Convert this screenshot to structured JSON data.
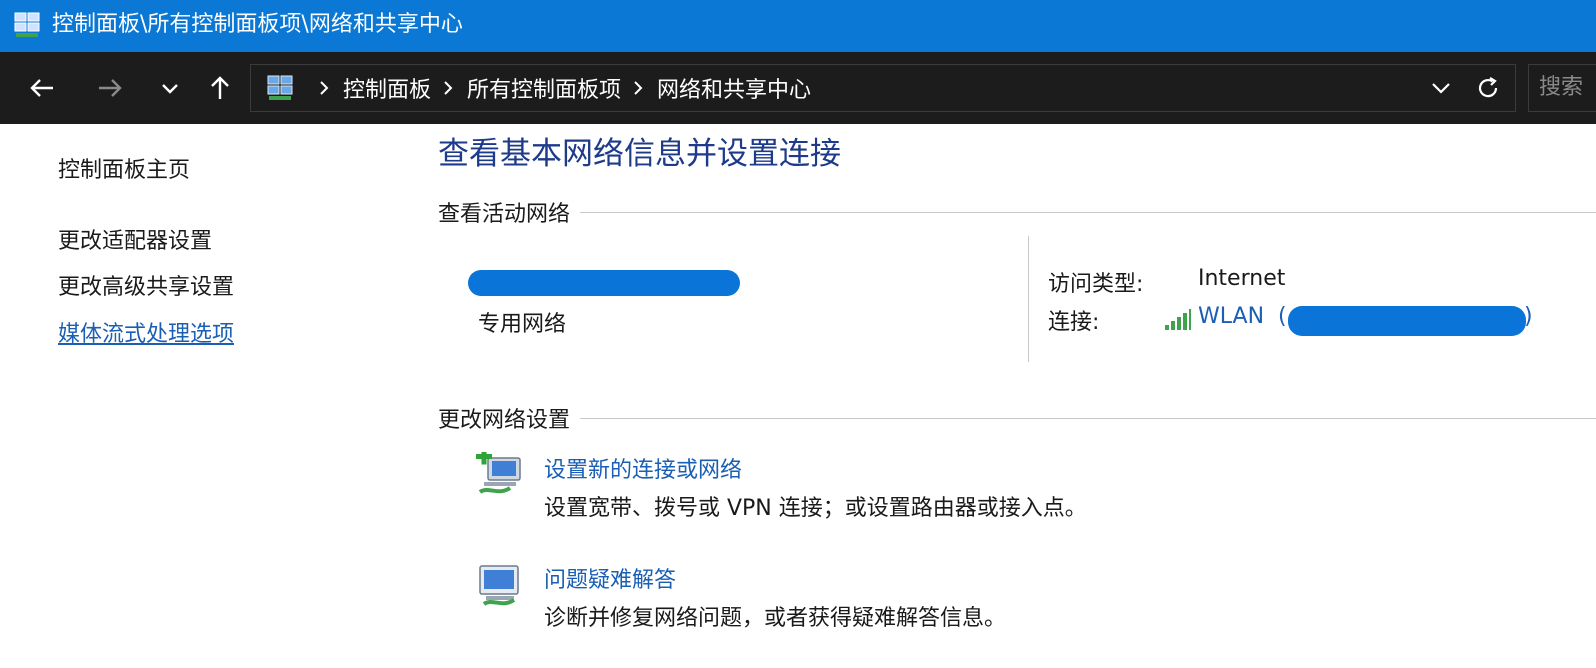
{
  "window": {
    "title": "控制面板\\所有控制面板项\\网络和共享中心"
  },
  "navbar": {
    "breadcrumbs": [
      "控制面板",
      "所有控制面板项",
      "网络和共享中心"
    ],
    "search_placeholder": "搜索"
  },
  "sidebar": {
    "items": [
      {
        "label": "控制面板主页"
      },
      {
        "label": "更改适配器设置"
      },
      {
        "label": "更改高级共享设置"
      },
      {
        "label": "媒体流式处理选项"
      }
    ]
  },
  "main": {
    "title": "查看基本网络信息并设置连接",
    "active_networks_heading": "查看活动网络",
    "network": {
      "type": "专用网络",
      "access_type_label": "访问类型:",
      "access_type_value": "Internet",
      "connection_label": "连接:",
      "connection_value": "WLAN",
      "paren_open": "(",
      "paren_close": ")"
    },
    "change_settings_heading": "更改网络设置",
    "tasks": [
      {
        "title": "设置新的连接或网络",
        "description": "设置宽带、拨号或 VPN 连接；或设置路由器或接入点。"
      },
      {
        "title": "问题疑难解答",
        "description": "诊断并修复网络问题，或者获得疑难解答信息。"
      }
    ]
  },
  "colors": {
    "titlebar": "#0a78d4",
    "navbar": "#1c1c1c",
    "link": "#1a5fb4",
    "heading": "#1e3a8a",
    "redaction": "#0a74d8"
  }
}
